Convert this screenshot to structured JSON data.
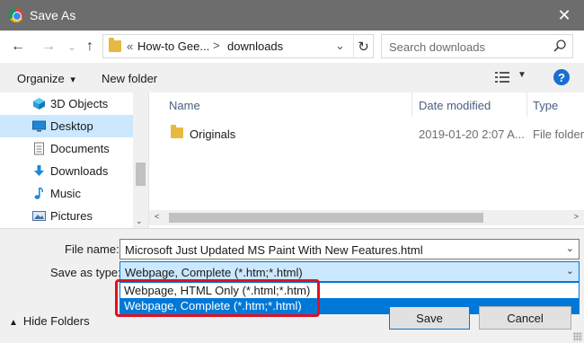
{
  "window": {
    "title": "Save As",
    "close_glyph": "✕"
  },
  "nav": {
    "back": "←",
    "forward": "→",
    "up": "↑",
    "breadcrumb": {
      "prefix": "«",
      "segments": [
        "How-to Gee...",
        "downloads"
      ],
      "separator": ">"
    },
    "search_placeholder": "Search downloads"
  },
  "toolbar": {
    "organize": "Organize",
    "organize_caret": "▾",
    "new_folder": "New folder",
    "help": "?"
  },
  "sidebar": {
    "items": [
      {
        "label": "3D Objects",
        "icon": "cube-icon",
        "selected": false
      },
      {
        "label": "Desktop",
        "icon": "desktop-icon",
        "selected": true
      },
      {
        "label": "Documents",
        "icon": "documents-icon",
        "selected": false
      },
      {
        "label": "Downloads",
        "icon": "download-arrow-icon",
        "selected": false
      },
      {
        "label": "Music",
        "icon": "music-note-icon",
        "selected": false
      },
      {
        "label": "Pictures",
        "icon": "pictures-icon",
        "selected": false
      }
    ]
  },
  "file_list": {
    "columns": {
      "name": "Name",
      "date": "Date modified",
      "type": "Type"
    },
    "rows": [
      {
        "name": "Originals",
        "date": "2019-01-20 2:07 A...",
        "type": "File folder"
      }
    ]
  },
  "form": {
    "file_name_label": "File name:",
    "file_name_value": "Microsoft Just Updated MS Paint With New Features.html",
    "save_type_label": "Save as type:",
    "save_type_value": "Webpage, Complete (*.htm;*.html)",
    "type_options": [
      "Webpage, HTML Only (*.html;*.htm)",
      "Webpage, Complete (*.htm;*.html)"
    ],
    "highlighted_option": 1
  },
  "footer": {
    "hide_folders": "Hide Folders",
    "save": "Save",
    "cancel": "Cancel"
  },
  "colors": {
    "accent": "#0078d7",
    "annotation_red": "#e0101f",
    "selection": "#cce8ff"
  }
}
